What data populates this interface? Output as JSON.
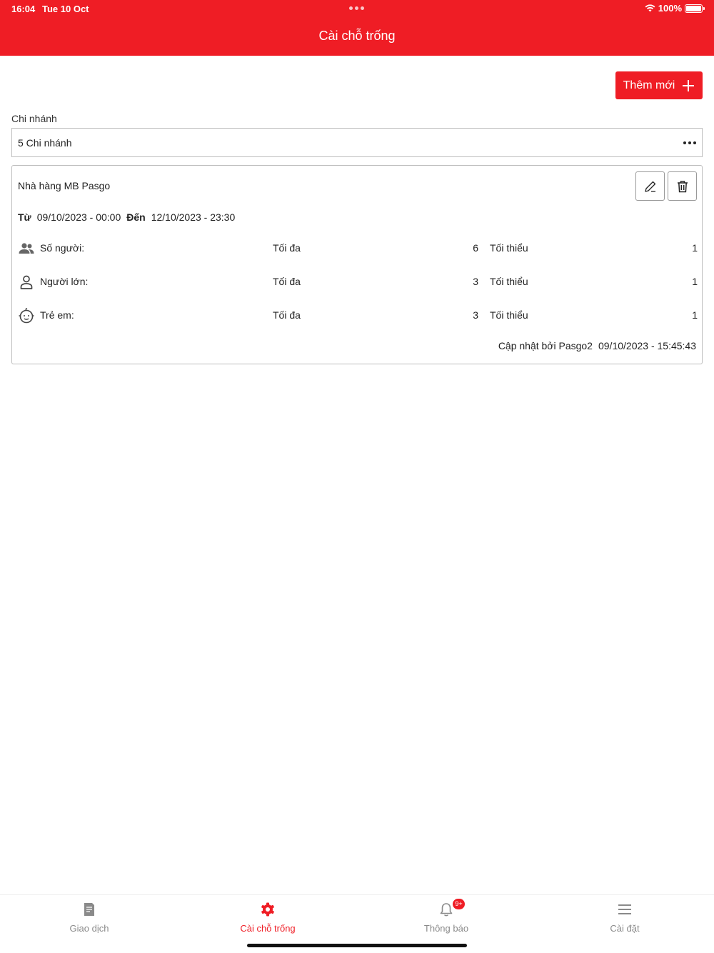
{
  "status": {
    "time": "16:04",
    "date": "Tue 10 Oct",
    "battery": "100%"
  },
  "header": {
    "title": "Cài chỗ trống"
  },
  "toolbar": {
    "add_label": "Thêm mới"
  },
  "branch": {
    "label": "Chi nhánh",
    "value": "5 Chi nhánh"
  },
  "card": {
    "title": "Nhà hàng MB Pasgo",
    "from_label": "Từ",
    "from": "09/10/2023 - 00:00",
    "to_label": "Đến",
    "to": "12/10/2023 - 23:30",
    "rows": [
      {
        "icon": "group-icon",
        "label": "Số người:",
        "max_label": "Tối đa",
        "max": "6",
        "min_label": "Tối thiểu",
        "min": "1"
      },
      {
        "icon": "person-icon",
        "label": "Người lớn:",
        "max_label": "Tối đa",
        "max": "3",
        "min_label": "Tối thiểu",
        "min": "1"
      },
      {
        "icon": "baby-icon",
        "label": "Trẻ em:",
        "max_label": "Tối đa",
        "max": "3",
        "min_label": "Tối thiểu",
        "min": "1"
      }
    ],
    "updated_by": "Cập nhật bởi Pasgo2",
    "updated_at": "09/10/2023 - 15:45:43"
  },
  "tabs": [
    {
      "label": "Giao dịch",
      "icon": "document-icon"
    },
    {
      "label": "Cài chỗ trống",
      "icon": "gear-icon"
    },
    {
      "label": "Thông báo",
      "icon": "bell-icon",
      "badge": "9+"
    },
    {
      "label": "Cài đặt",
      "icon": "menu-icon"
    }
  ],
  "colors": {
    "accent": "#ef1d25",
    "inactive": "#8a8a8a"
  }
}
